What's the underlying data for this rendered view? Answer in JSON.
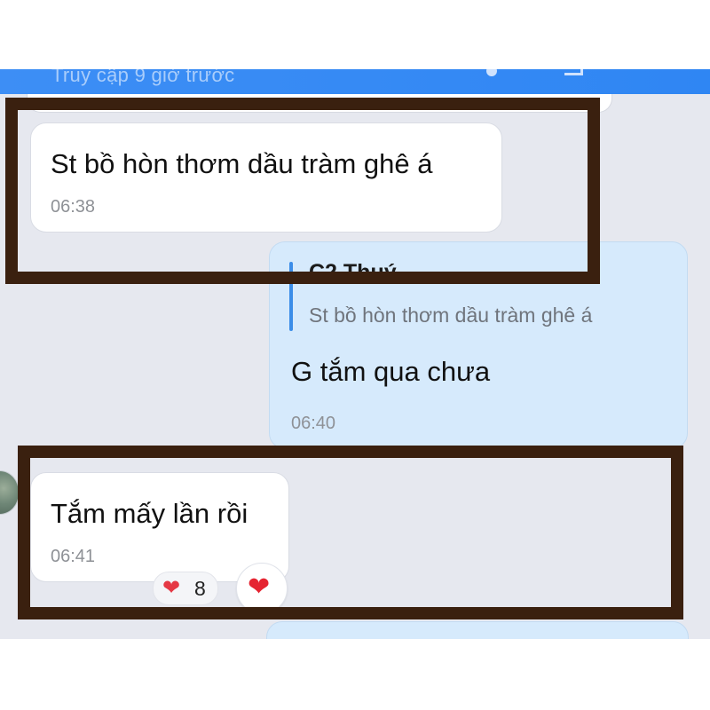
{
  "header": {
    "status_text": "Truy cập 9 giờ trước"
  },
  "messages": [
    {
      "direction": "incoming",
      "text": "St bồ hòn thơm dầu tràm ghê á",
      "time": "06:38"
    },
    {
      "direction": "outgoing",
      "quote": {
        "sender": "C2 Thuý",
        "text": "St bồ hòn thơm dầu tràm ghê á"
      },
      "text": "G tắm qua chưa",
      "time": "06:40"
    },
    {
      "direction": "incoming",
      "text": "Tắm mấy lần rồi",
      "time": "06:41",
      "reactions": {
        "icon": "heart-icon",
        "symbol": "❤",
        "count": "8"
      },
      "react_button_symbol": "❤"
    }
  ],
  "colors": {
    "header": "#2f86f3",
    "chat_background": "#e6e8ef",
    "incoming_bubble": "#ffffff",
    "outgoing_bubble": "#d6eafc",
    "quote_bar": "#3b8de8",
    "highlight_frame": "#3a200f",
    "heart": "#e53945"
  }
}
